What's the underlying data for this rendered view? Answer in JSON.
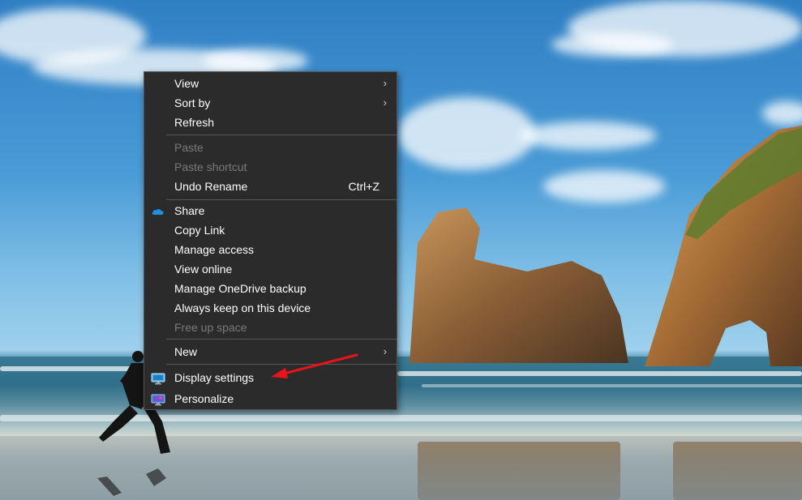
{
  "menu": {
    "items": [
      {
        "label": "View",
        "submenu": true,
        "disabled": false
      },
      {
        "label": "Sort by",
        "submenu": true,
        "disabled": false
      },
      {
        "label": "Refresh",
        "submenu": false,
        "disabled": false
      },
      {
        "label": "Paste",
        "submenu": false,
        "disabled": true
      },
      {
        "label": "Paste shortcut",
        "submenu": false,
        "disabled": true
      },
      {
        "label": "Undo Rename",
        "shortcut": "Ctrl+Z",
        "submenu": false,
        "disabled": false
      },
      {
        "label": "Share",
        "icon": "onedrive-cloud-icon",
        "submenu": false,
        "disabled": false
      },
      {
        "label": "Copy Link",
        "submenu": false,
        "disabled": false
      },
      {
        "label": "Manage access",
        "submenu": false,
        "disabled": false
      },
      {
        "label": "View online",
        "submenu": false,
        "disabled": false
      },
      {
        "label": "Manage OneDrive backup",
        "submenu": false,
        "disabled": false
      },
      {
        "label": "Always keep on this device",
        "submenu": false,
        "disabled": false
      },
      {
        "label": "Free up space",
        "submenu": false,
        "disabled": true
      },
      {
        "label": "New",
        "submenu": true,
        "disabled": false
      },
      {
        "label": "Display settings",
        "icon": "display-settings-icon",
        "submenu": false,
        "disabled": false
      },
      {
        "label": "Personalize",
        "icon": "personalize-icon",
        "submenu": false,
        "disabled": false
      }
    ],
    "chevron": "›"
  },
  "colors": {
    "menu_bg": "#2b2b2b",
    "menu_text": "#ffffff",
    "disabled_text": "#7a7a7a",
    "annotation_arrow": "#e8141c",
    "onedrive_blue": "#1e8fe1"
  }
}
